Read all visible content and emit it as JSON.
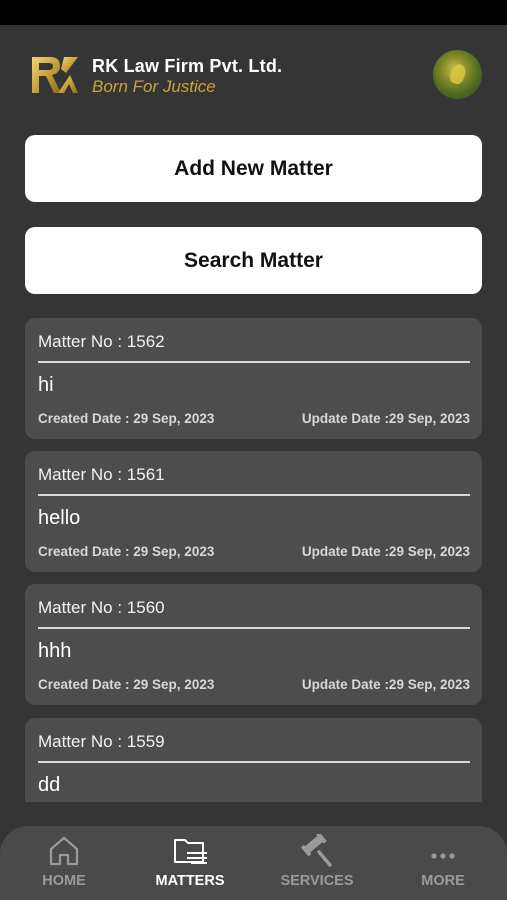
{
  "header": {
    "firm_name": "RK Law Firm Pvt. Ltd.",
    "tagline": "Born For Justice",
    "logo_text": "RK",
    "brand_color": "#c9a43b"
  },
  "actions": {
    "add_label": "Add New Matter",
    "search_label": "Search Matter"
  },
  "matters": [
    {
      "no": "Matter No : 1562",
      "title": "hi",
      "created": "Created Date : 29 Sep, 2023",
      "updated": "Update Date :29 Sep, 2023"
    },
    {
      "no": "Matter No : 1561",
      "title": "hello",
      "created": "Created Date : 29 Sep, 2023",
      "updated": "Update Date :29 Sep, 2023"
    },
    {
      "no": "Matter No : 1560",
      "title": "hhh",
      "created": "Created Date : 29 Sep, 2023",
      "updated": "Update Date :29 Sep, 2023"
    },
    {
      "no": "Matter No : 1559",
      "title": "dd",
      "created": "",
      "updated": ""
    }
  ],
  "nav": {
    "home": {
      "label": "HOME",
      "icon": "home-icon"
    },
    "matters": {
      "label": "MATTERS",
      "icon": "folder-icon"
    },
    "services": {
      "label": "SERVICES",
      "icon": "gavel-icon"
    },
    "more": {
      "label": "MORE",
      "icon": "more-icon"
    }
  }
}
